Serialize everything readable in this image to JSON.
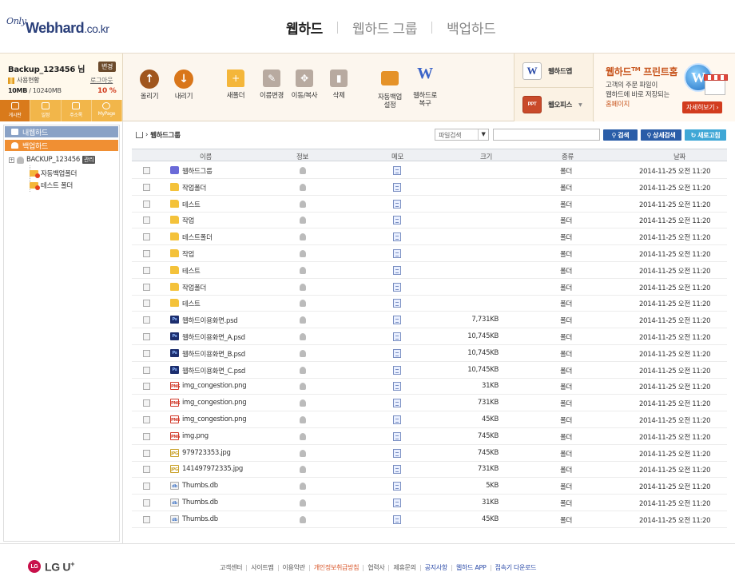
{
  "header": {
    "logo_only": "Only",
    "logo_web": "Webhard",
    "logo_cokr": ".co.kr",
    "tabs": [
      {
        "label": "웹하드",
        "active": true
      },
      {
        "label": "웹하드 그룹",
        "active": false
      },
      {
        "label": "백업하드",
        "active": false
      }
    ]
  },
  "user": {
    "name": "Backup_123456 님",
    "change": "변경",
    "usage_label": "사용현황",
    "logout": "로그아웃",
    "used": "10MB",
    "total": "/ 10240MB",
    "percent": "10 %"
  },
  "quick": [
    "게시판",
    "일정",
    "주소록",
    "MyPage"
  ],
  "toolbar": {
    "upload": "올리기",
    "download": "내리기",
    "new_folder": "새폴더",
    "rename": "이름변경",
    "move_copy": "이동/복사",
    "delete": "삭제",
    "auto_backup_1": "자동백업",
    "auto_backup_2": "설정",
    "restore_1": "웹하드로",
    "restore_2": "복구"
  },
  "apps": {
    "webhard_app": "웹하드앱",
    "web_office": "웹오피스",
    "app_icon": "W",
    "ppt_icon": "PPT"
  },
  "promo": {
    "title": "웹하드",
    "tm": "TM",
    "title2": "프린트홈",
    "line1": "고객의 주문 파일이",
    "line2": "웹하드에 바로 저장되는",
    "line3": "홈페이지",
    "button": "자세히보기 ›",
    "globe": "W"
  },
  "sidebar": {
    "my_hard": "내웹하드",
    "backup_hard": "백업하드",
    "root": "BACKUP_123456",
    "root_badge": "관리",
    "children": [
      "자동백업폴더",
      "테스트 폴더"
    ]
  },
  "breadcrumb": {
    "current": "웹하드그룹"
  },
  "search": {
    "select": "파일검색",
    "search_btn": "검색",
    "detail_btn": "상세검색",
    "refresh_btn": "새로고침"
  },
  "columns": [
    "이름",
    "정보",
    "메모",
    "크기",
    "종류",
    "날짜"
  ],
  "files": [
    {
      "name": "웹하드그룹",
      "type": "group",
      "size": "",
      "kind": "폴더",
      "date": "2014-11-25 오전 11:20"
    },
    {
      "name": "작업폴더",
      "type": "folder",
      "size": "",
      "kind": "폴더",
      "date": "2014-11-25 오전 11:20"
    },
    {
      "name": "테스트",
      "type": "folder",
      "size": "",
      "kind": "폴더",
      "date": "2014-11-25 오전 11:20"
    },
    {
      "name": "작업",
      "type": "folder",
      "size": "",
      "kind": "폴더",
      "date": "2014-11-25 오전 11:20"
    },
    {
      "name": "테스트폴더",
      "type": "folder",
      "size": "",
      "kind": "폴더",
      "date": "2014-11-25 오전 11:20"
    },
    {
      "name": "작업",
      "type": "folder",
      "size": "",
      "kind": "폴더",
      "date": "2014-11-25 오전 11:20"
    },
    {
      "name": "테스트",
      "type": "folder",
      "size": "",
      "kind": "폴더",
      "date": "2014-11-25 오전 11:20"
    },
    {
      "name": "작업폴더",
      "type": "folder",
      "size": "",
      "kind": "폴더",
      "date": "2014-11-25 오전 11:20"
    },
    {
      "name": "테스트",
      "type": "folder",
      "size": "",
      "kind": "폴더",
      "date": "2014-11-25 오전 11:20"
    },
    {
      "name": "웹하드이용화면.psd",
      "type": "psd",
      "size": "7,731KB",
      "kind": "폴더",
      "date": "2014-11-25 오전 11:20"
    },
    {
      "name": "웹하드이용화면_A.psd",
      "type": "psd",
      "size": "10,745KB",
      "kind": "폴더",
      "date": "2014-11-25 오전 11:20"
    },
    {
      "name": "웹하드이용화면_B.psd",
      "type": "psd",
      "size": "10,745KB",
      "kind": "폴더",
      "date": "2014-11-25 오전 11:20"
    },
    {
      "name": "웹하드이용화면_C.psd",
      "type": "psd",
      "size": "10,745KB",
      "kind": "폴더",
      "date": "2014-11-25 오전 11:20"
    },
    {
      "name": "img_congestion.png",
      "type": "png",
      "size": "31KB",
      "kind": "폴더",
      "date": "2014-11-25 오전 11:20"
    },
    {
      "name": "img_congestion.png",
      "type": "png",
      "size": "731KB",
      "kind": "폴더",
      "date": "2014-11-25 오전 11:20"
    },
    {
      "name": "img_congestion.png",
      "type": "png",
      "size": "45KB",
      "kind": "폴더",
      "date": "2014-11-25 오전 11:20"
    },
    {
      "name": "img.png",
      "type": "png",
      "size": "745KB",
      "kind": "폴더",
      "date": "2014-11-25 오전 11:20"
    },
    {
      "name": "979723353.jpg",
      "type": "jpg",
      "size": "745KB",
      "kind": "폴더",
      "date": "2014-11-25 오전 11:20"
    },
    {
      "name": "141497972335.jpg",
      "type": "jpg",
      "size": "731KB",
      "kind": "폴더",
      "date": "2014-11-25 오전 11:20"
    },
    {
      "name": "Thumbs.db",
      "type": "db",
      "size": "5KB",
      "kind": "폴더",
      "date": "2014-11-25 오전 11:20"
    },
    {
      "name": "Thumbs.db",
      "type": "db",
      "size": "31KB",
      "kind": "폴더",
      "date": "2014-11-25 오전 11:20"
    },
    {
      "name": "Thumbs.db",
      "type": "db",
      "size": "45KB",
      "kind": "폴더",
      "date": "2014-11-25 오전 11:20"
    }
  ],
  "footer": {
    "brand": "LG U",
    "brand_plus": "+",
    "brand_dot": "LG",
    "links": [
      {
        "label": "고객센터",
        "style": ""
      },
      {
        "label": "사이트맵",
        "style": ""
      },
      {
        "label": "이용약관",
        "style": ""
      },
      {
        "label": "개인정보취급방침",
        "style": "hl"
      },
      {
        "label": "협력사",
        "style": ""
      },
      {
        "label": "제휴문의",
        "style": ""
      },
      {
        "label": "공지사항",
        "style": "bl"
      },
      {
        "label": "웹하드 APP",
        "style": "bl"
      },
      {
        "label": "접속기 다운로드",
        "style": "bl"
      }
    ]
  },
  "colors": {
    "accent_orange": "#f08f33",
    "brand_blue": "#2a3f7a",
    "search_blue": "#2a5da8",
    "refresh_blue": "#3fa7d6",
    "alert_red": "#d23c1e"
  }
}
